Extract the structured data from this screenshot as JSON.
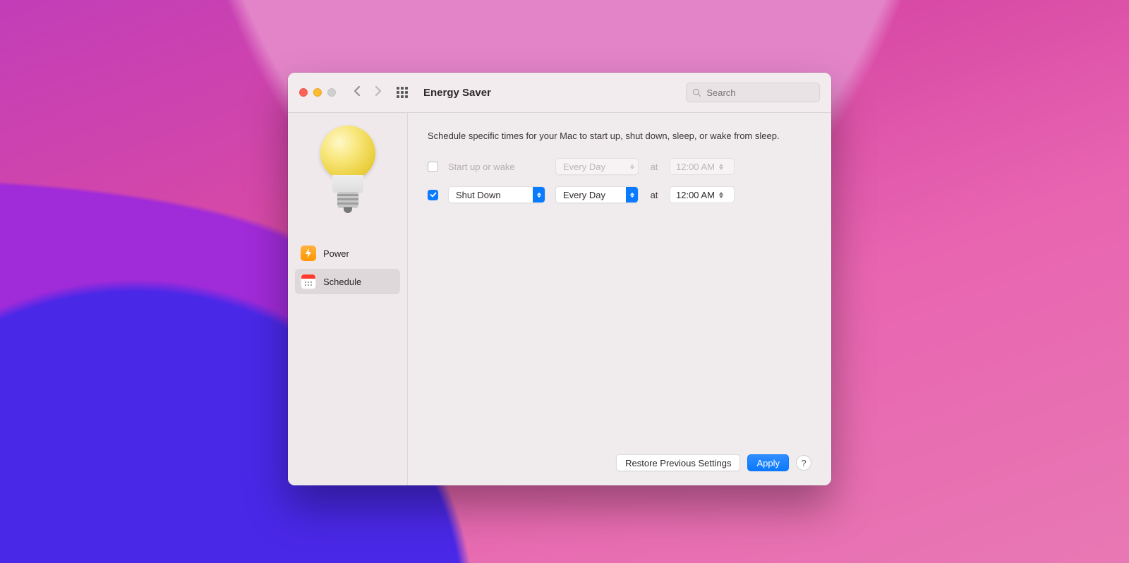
{
  "header": {
    "title": "Energy Saver",
    "search_placeholder": "Search"
  },
  "sidebar": {
    "items": [
      {
        "label": "Power"
      },
      {
        "label": "Schedule"
      }
    ],
    "selected": 1
  },
  "content": {
    "description": "Schedule specific times for your Mac to start up, shut down, sleep, or wake from sleep.",
    "rows": [
      {
        "enabled": false,
        "label": "Start up or wake",
        "day": "Every Day",
        "at": "at",
        "time": "12:00 AM"
      },
      {
        "enabled": true,
        "action": "Shut Down",
        "day": "Every Day",
        "at": "at",
        "time": "12:00 AM"
      }
    ]
  },
  "footer": {
    "restore": "Restore Previous Settings",
    "apply": "Apply",
    "help": "?"
  }
}
